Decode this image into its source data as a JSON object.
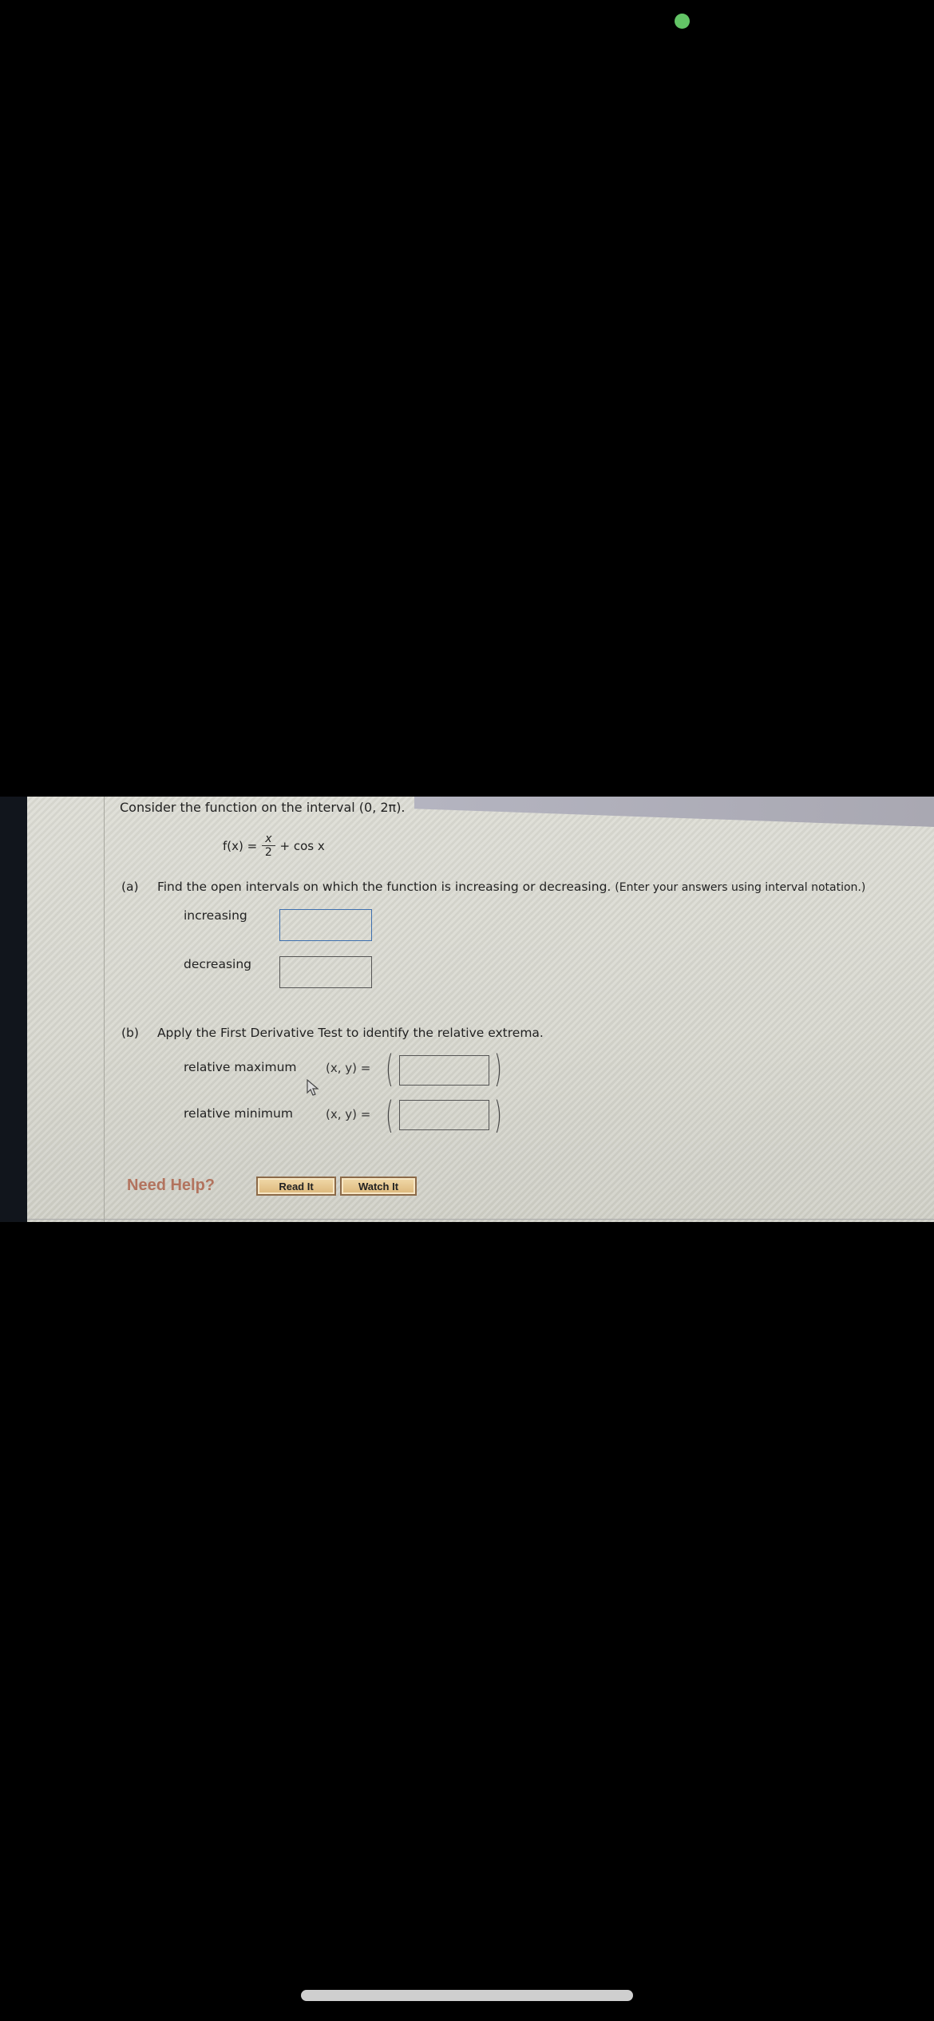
{
  "status": {
    "indicator_color": "#63c466"
  },
  "problem": {
    "intro": "Consider the function on the interval (0, 2π).",
    "formula": {
      "lhs": "f(x) =",
      "numerator": "x",
      "denominator": "2",
      "rest": "+ cos x"
    },
    "part_a": {
      "label": "(a)",
      "text": "Find the open intervals on which the function is increasing or decreasing.",
      "note": "(Enter your answers using interval notation.)",
      "increasing_label": "increasing",
      "increasing_value": "",
      "decreasing_label": "decreasing",
      "decreasing_value": ""
    },
    "part_b": {
      "label": "(b)",
      "text": "Apply the First Derivative Test to identify the relative extrema.",
      "max_label": "relative maximum",
      "min_label": "relative minimum",
      "xy_label": "(x, y) =",
      "open_paren": "(",
      "close_paren": ")",
      "max_value": "",
      "min_value": ""
    }
  },
  "help": {
    "label": "Need Help?",
    "read_button": "Read It",
    "watch_button": "Watch It"
  }
}
